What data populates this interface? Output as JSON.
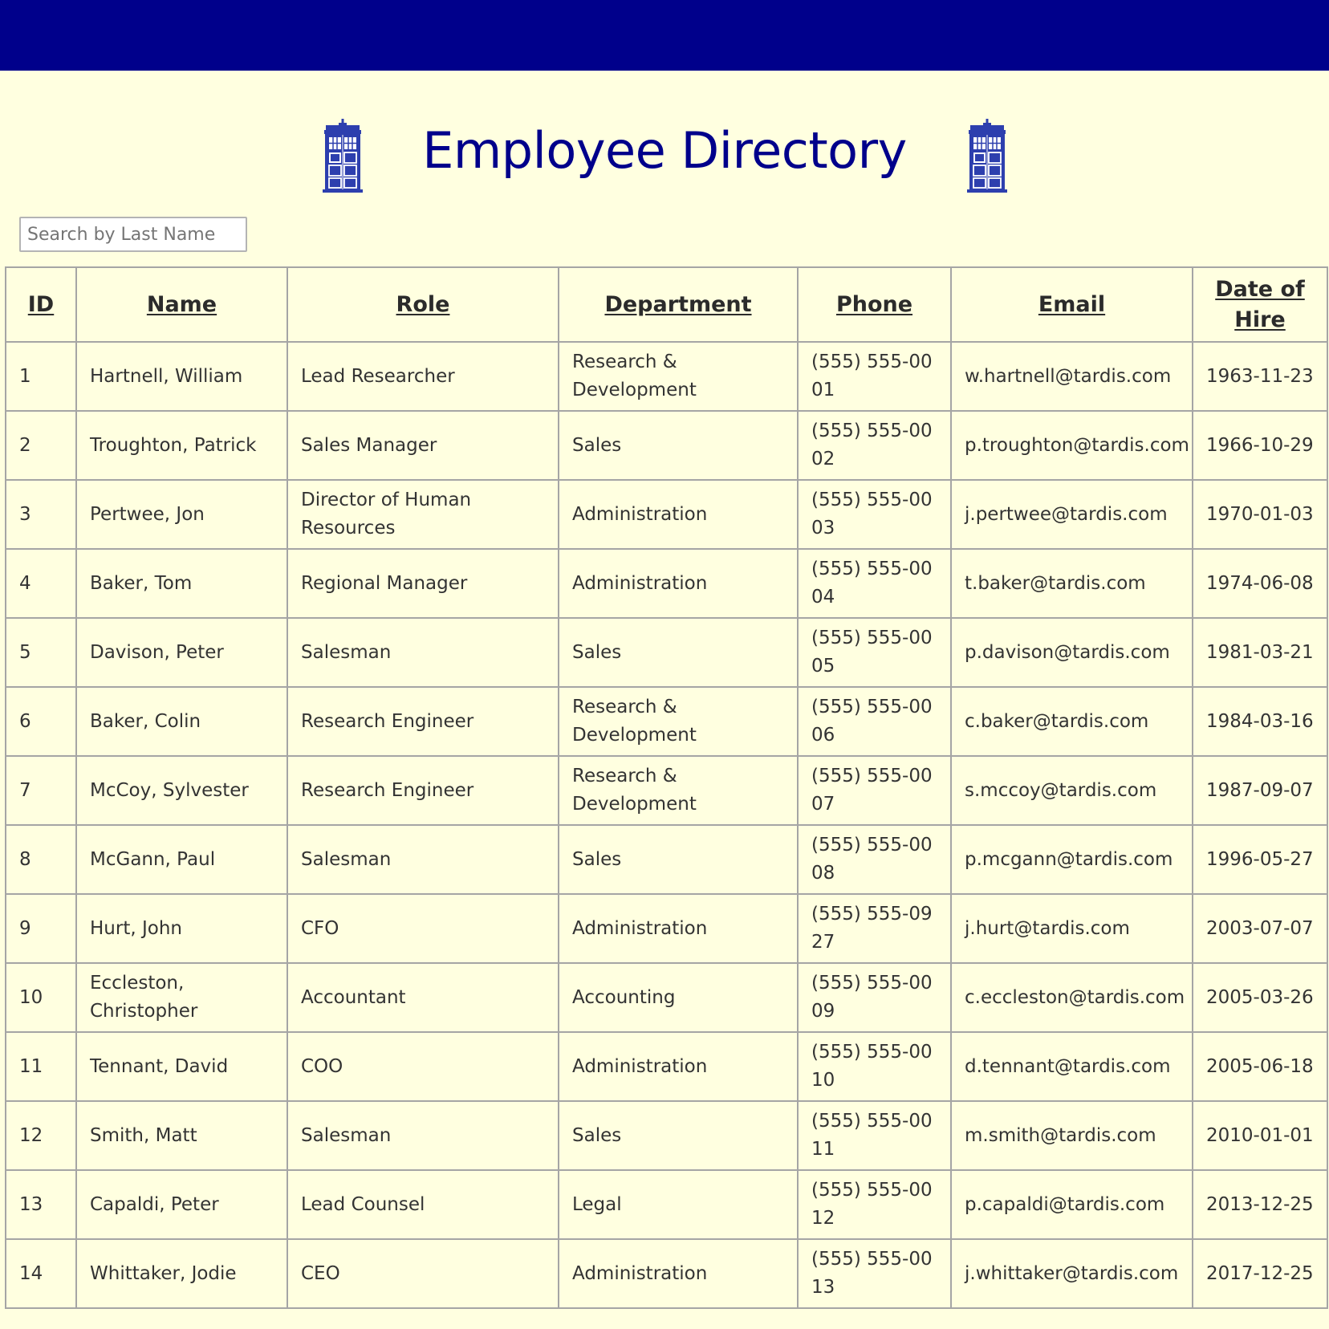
{
  "app": {
    "title": "Employee Directory",
    "brand_color": "#00008b",
    "background_color": "#ffffe0",
    "icon": "tardis-icon"
  },
  "search": {
    "placeholder": "Search by Last Name",
    "value": ""
  },
  "table": {
    "columns": [
      "ID",
      "Name",
      "Role",
      "Department",
      "Phone",
      "Email",
      "Date of Hire"
    ],
    "rows": [
      {
        "id": "1",
        "name": "Hartnell, William",
        "role": "Lead Researcher",
        "department": "Research & Development",
        "phone": "(555) 555-0001",
        "email": "w.hartnell@tardis.com",
        "hire_date": "1963-11-23"
      },
      {
        "id": "2",
        "name": "Troughton, Patrick",
        "role": "Sales Manager",
        "department": "Sales",
        "phone": "(555) 555-0002",
        "email": "p.troughton@tardis.com",
        "hire_date": "1966-10-29"
      },
      {
        "id": "3",
        "name": "Pertwee, Jon",
        "role": "Director of Human Resources",
        "department": "Administration",
        "phone": "(555) 555-0003",
        "email": "j.pertwee@tardis.com",
        "hire_date": "1970-01-03"
      },
      {
        "id": "4",
        "name": "Baker, Tom",
        "role": "Regional Manager",
        "department": "Administration",
        "phone": "(555) 555-0004",
        "email": "t.baker@tardis.com",
        "hire_date": "1974-06-08"
      },
      {
        "id": "5",
        "name": "Davison, Peter",
        "role": "Salesman",
        "department": "Sales",
        "phone": "(555) 555-0005",
        "email": "p.davison@tardis.com",
        "hire_date": "1981-03-21"
      },
      {
        "id": "6",
        "name": "Baker, Colin",
        "role": "Research Engineer",
        "department": "Research & Development",
        "phone": "(555) 555-0006",
        "email": "c.baker@tardis.com",
        "hire_date": "1984-03-16"
      },
      {
        "id": "7",
        "name": "McCoy, Sylvester",
        "role": "Research Engineer",
        "department": "Research & Development",
        "phone": "(555) 555-0007",
        "email": "s.mccoy@tardis.com",
        "hire_date": "1987-09-07"
      },
      {
        "id": "8",
        "name": "McGann, Paul",
        "role": "Salesman",
        "department": "Sales",
        "phone": "(555) 555-0008",
        "email": "p.mcgann@tardis.com",
        "hire_date": "1996-05-27"
      },
      {
        "id": "9",
        "name": "Hurt, John",
        "role": "CFO",
        "department": "Administration",
        "phone": "(555) 555-0927",
        "email": "j.hurt@tardis.com",
        "hire_date": "2003-07-07"
      },
      {
        "id": "10",
        "name": "Eccleston, Christopher",
        "role": "Accountant",
        "department": "Accounting",
        "phone": "(555) 555-0009",
        "email": "c.eccleston@tardis.com",
        "hire_date": "2005-03-26"
      },
      {
        "id": "11",
        "name": "Tennant, David",
        "role": "COO",
        "department": "Administration",
        "phone": "(555) 555-0010",
        "email": "d.tennant@tardis.com",
        "hire_date": "2005-06-18"
      },
      {
        "id": "12",
        "name": "Smith, Matt",
        "role": "Salesman",
        "department": "Sales",
        "phone": "(555) 555-0011",
        "email": "m.smith@tardis.com",
        "hire_date": "2010-01-01"
      },
      {
        "id": "13",
        "name": "Capaldi, Peter",
        "role": "Lead Counsel",
        "department": "Legal",
        "phone": "(555) 555-0012",
        "email": "p.capaldi@tardis.com",
        "hire_date": "2013-12-25"
      },
      {
        "id": "14",
        "name": "Whittaker, Jodie",
        "role": "CEO",
        "department": "Administration",
        "phone": "(555) 555-0013",
        "email": "j.whittaker@tardis.com",
        "hire_date": "2017-12-25"
      }
    ]
  }
}
